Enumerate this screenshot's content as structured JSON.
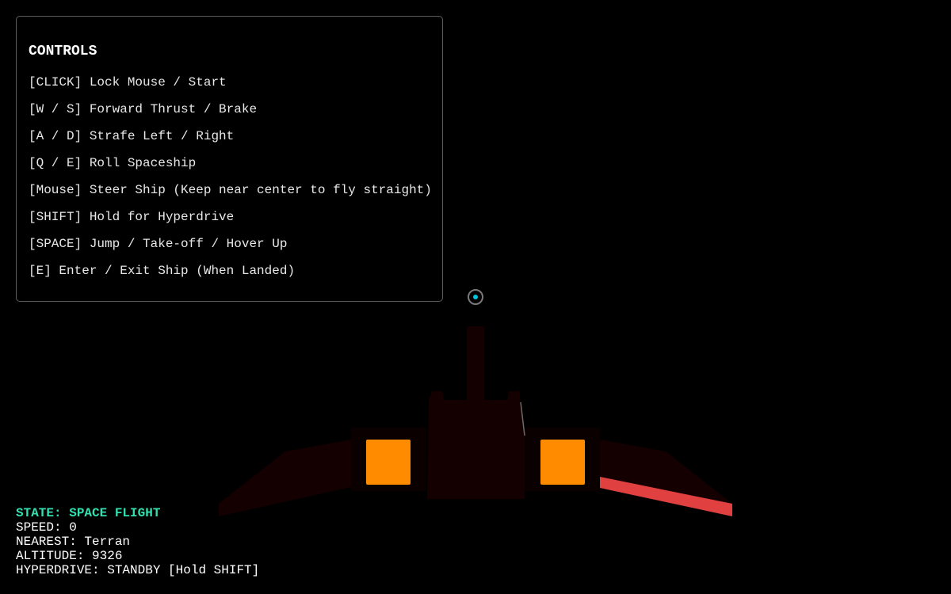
{
  "controls": {
    "title": "CONTROLS",
    "items": [
      "[CLICK] Lock Mouse / Start",
      "[W / S] Forward Thrust / Brake",
      "[A / D] Strafe Left / Right",
      "[Q / E] Roll Spaceship",
      "[Mouse] Steer Ship (Keep near center to fly straight)",
      "[SHIFT] Hold for Hyperdrive",
      "[SPACE] Jump / Take-off / Hover Up",
      "[E] Enter / Exit Ship (When Landed)"
    ]
  },
  "hud": {
    "state": "STATE: SPACE FLIGHT",
    "speed": "SPEED: 0",
    "nearest": "NEAREST: Terran",
    "altitude": "ALTITUDE: 9326",
    "hyperdrive": "HYPERDRIVE: STANDBY [Hold SHIFT]"
  },
  "colors": {
    "background": "#000000",
    "hull": "#140000",
    "engine_glow": "#ff8c00",
    "wing_stripe": "#e04040",
    "crosshair_dot": "#00c8e0",
    "state_text": "#33e0b0"
  },
  "icons": {
    "crosshair": "crosshair-reticle-icon"
  }
}
